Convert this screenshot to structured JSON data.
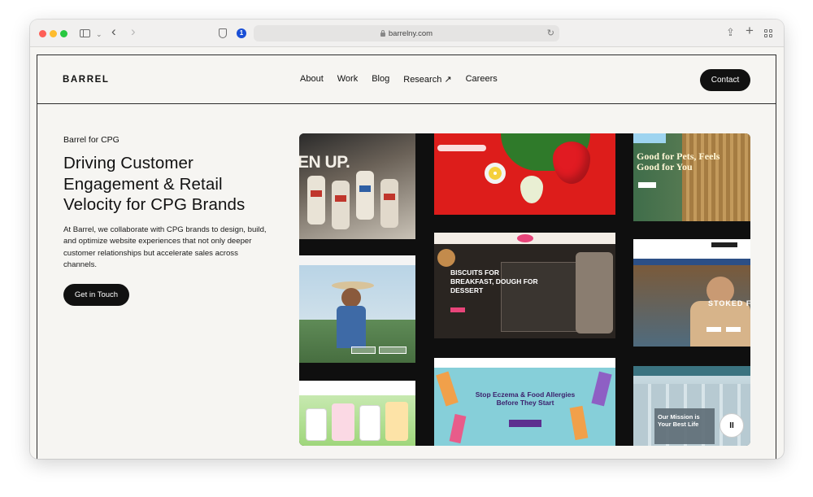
{
  "browser": {
    "url": "barrelny.com",
    "extension_badge": "1",
    "icons": [
      "sidebar-icon",
      "chevron-down-icon",
      "back-icon",
      "forward-icon",
      "shield-icon",
      "lock-icon",
      "reload-icon",
      "share-icon",
      "plus-icon",
      "tab-grid-icon"
    ]
  },
  "site": {
    "logo": "BARREL",
    "nav": [
      "About",
      "Work",
      "Blog",
      "Research ↗",
      "Careers"
    ],
    "contact_label": "Contact"
  },
  "hero": {
    "eyebrow": "Barrel for CPG",
    "headline": "Driving Customer Engagement & Retail Velocity for CPG Brands",
    "body": "At Barrel, we collaborate with CPG brands to design, build, and optimize website experiences that not only deeper customer relationships but accelerate sales across channels.",
    "cta_label": "Get in Touch"
  },
  "gallery": {
    "tiles": [
      {
        "caption": "EN UP."
      },
      {
        "caption": ""
      },
      {
        "caption": ""
      },
      {
        "caption": ""
      },
      {
        "caption": "BISCUITS FOR BREAKFAST, DOUGH FOR DESSERT"
      },
      {
        "caption": "Stop Eczema & Food Allergies Before They Start"
      },
      {
        "caption": "Good for Pets, Feels Good for You"
      },
      {
        "caption": "STOKED FOR WIN"
      },
      {
        "caption": "Our Mission is Your Best Life"
      }
    ],
    "pause_label": "II"
  },
  "colors": {
    "accent_dark": "#111111",
    "page_bg": "#f6f5f2",
    "red_tile": "#e01d1d",
    "teal_tile": "#7dcbd6"
  }
}
